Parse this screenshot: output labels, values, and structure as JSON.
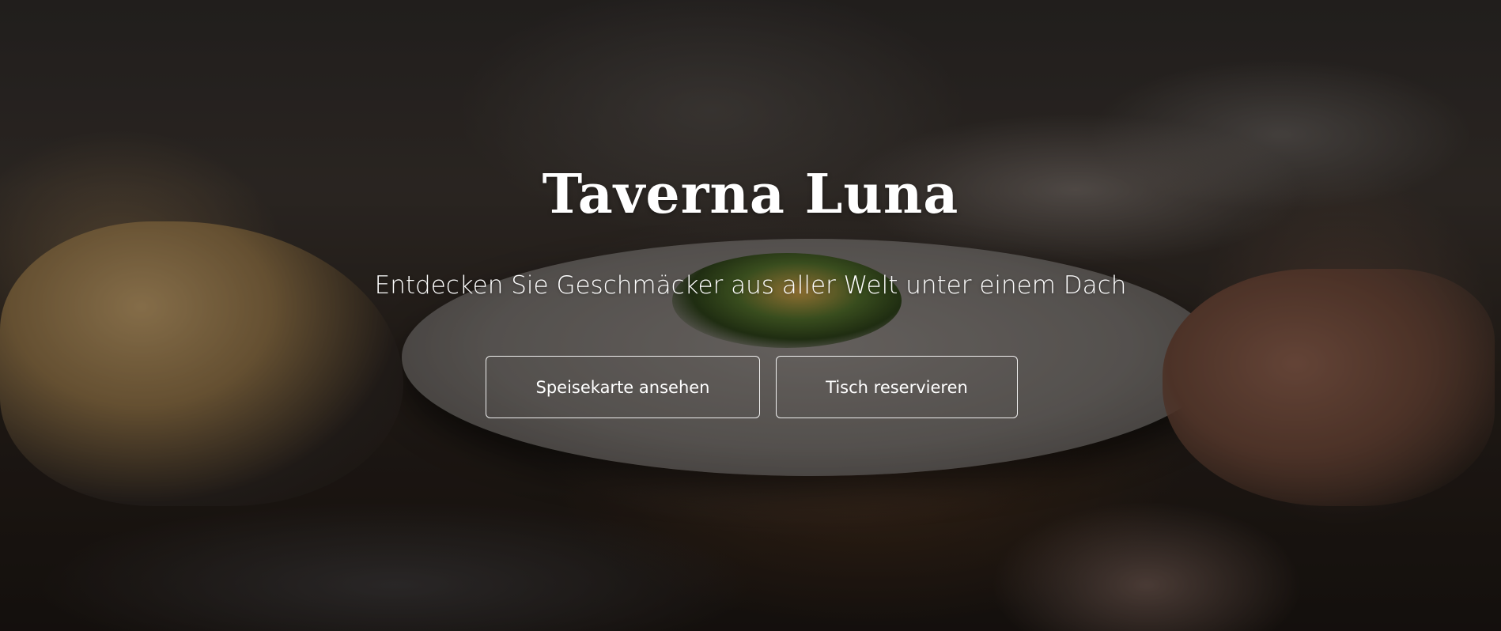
{
  "hero": {
    "title": "Taverna Luna",
    "tagline": "Entdecken Sie Geschmäcker aus aller Welt unter einem Dach",
    "buttons": {
      "menu_label": "Speisekarte ansehen",
      "reserve_label": "Tisch reservieren"
    },
    "background_image": "restaurant-dinner-table-plate"
  },
  "colors": {
    "text": "#ffffff",
    "button_border": "#ffffff"
  }
}
